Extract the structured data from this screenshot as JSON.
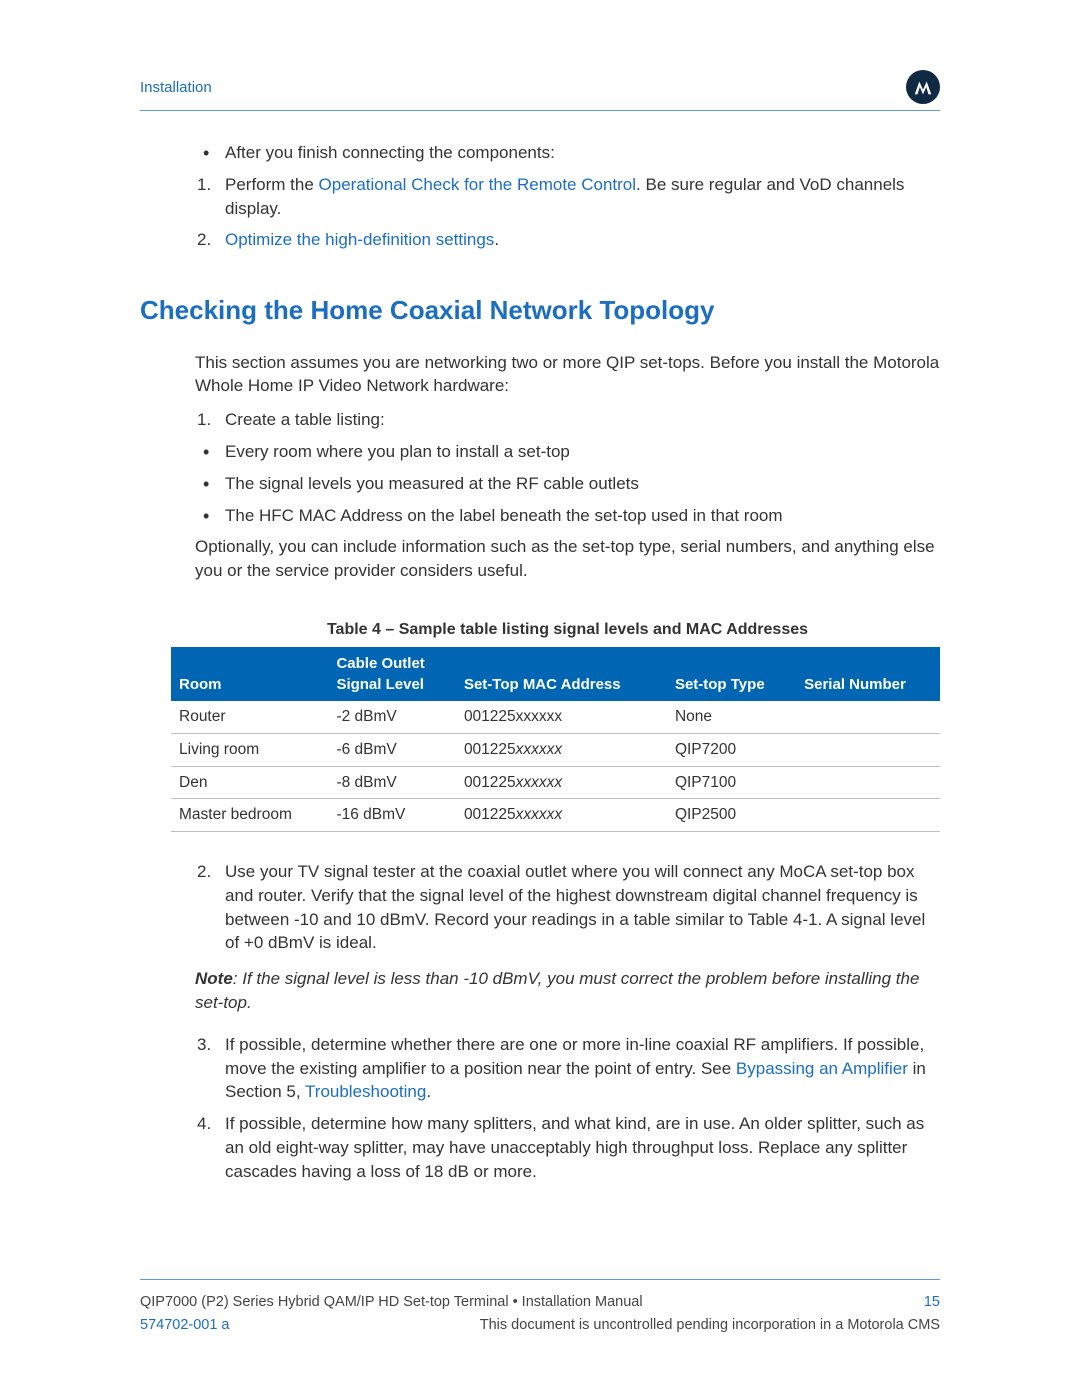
{
  "header": {
    "breadcrumb": "Installation"
  },
  "top": {
    "bullet1": "After you finish connecting the components:",
    "step1_pre": "Perform the ",
    "step1_link": "Operational Check for the Remote Control",
    "step1_post": ". Be sure regular and VoD channels display.",
    "step2_link": "Optimize the high-definition settings",
    "step2_post": "."
  },
  "section_title": "Checking the Home Coaxial Network Topology",
  "intro": "This section assumes you are networking two or more QIP set-tops. Before you install the Motorola Whole Home IP Video Network hardware:",
  "s1_lead": "Create a table listing:",
  "s1_bullets": [
    "Every room where you plan to install a set-top",
    "The signal levels you measured at the RF cable outlets",
    "The HFC MAC Address on the label beneath the set-top used in that room"
  ],
  "optional_para": "Optionally, you can include information such as the set-top type, serial numbers, and anything else you or the service provider considers useful.",
  "table_caption": "Table 4 – Sample table listing signal levels and MAC Addresses",
  "table_headers": {
    "room": "Room",
    "signal": "Cable Outlet Signal Level",
    "mac": "Set-Top MAC Address",
    "type": "Set-top Type",
    "serial": "Serial Number"
  },
  "table_rows": [
    {
      "room": "Router",
      "signal": "-2 dBmV",
      "mac_prefix": "001225",
      "mac_suffix": "xxxxxx",
      "mac_italic": false,
      "type": "None",
      "serial": ""
    },
    {
      "room": "Living room",
      "signal": "-6 dBmV",
      "mac_prefix": "001225",
      "mac_suffix": "xxxxxx",
      "mac_italic": true,
      "type": "QIP7200",
      "serial": ""
    },
    {
      "room": "Den",
      "signal": "-8 dBmV",
      "mac_prefix": "001225",
      "mac_suffix": "xxxxxx",
      "mac_italic": true,
      "type": "QIP7100",
      "serial": ""
    },
    {
      "room": "Master bedroom",
      "signal": "-16 dBmV",
      "mac_prefix": "001225",
      "mac_suffix": "xxxxxx",
      "mac_italic": true,
      "type": "QIP2500",
      "serial": ""
    }
  ],
  "step2": "Use your TV signal tester at the coaxial outlet where you will connect any MoCA set-top box and router. Verify that the signal level of the highest downstream digital channel frequency is between -10 and 10 dBmV. Record your readings in a table similar to Table 4-1. A signal level of +0 dBmV is ideal.",
  "note_label": "Note",
  "note_body": ": If the signal level is less than -10 dBmV, you must correct the problem before installing the set-top.",
  "step3_pre": "If possible, determine whether there are one or more in-line coaxial RF amplifiers. If possible, move the existing amplifier to a position near the point of entry. See ",
  "step3_link1": "Bypassing an Amplifier",
  "step3_mid": " in Section 5, ",
  "step3_link2": "Troubleshooting",
  "step3_post": ".",
  "step4": "If possible, determine how many splitters, and what kind, are in use. An older splitter, such as an old eight-way splitter, may have unacceptably high throughput loss. Replace any splitter cascades having a loss of 18 dB or more.",
  "footer": {
    "title": "QIP7000 (P2) Series Hybrid QAM/IP HD Set-top Terminal • Installation Manual",
    "page": "15",
    "docnum": "574702-001 a",
    "disclaimer": "This document is uncontrolled pending incorporation in a Motorola CMS"
  }
}
